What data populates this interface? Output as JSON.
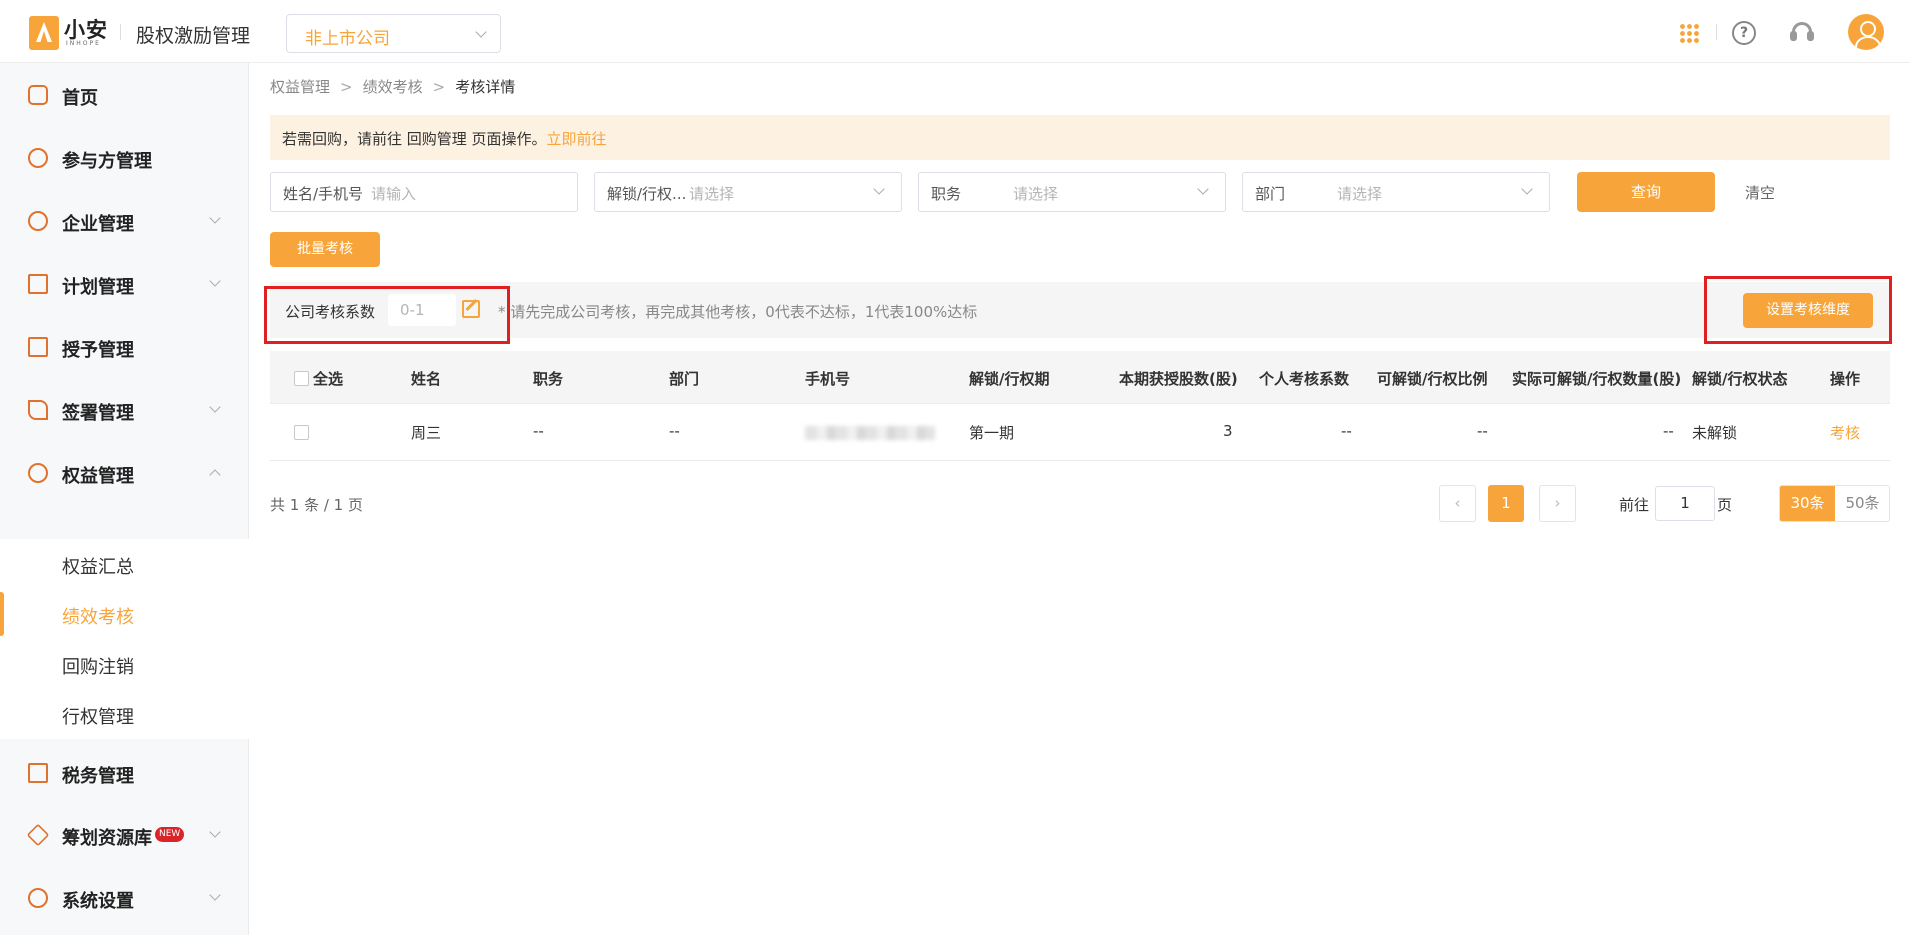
{
  "header": {
    "logo_text": "小安",
    "logo_sub": "INHOPE",
    "app_title": "股权激励管理",
    "company": "非上市公司"
  },
  "sidebar": {
    "items": [
      {
        "label": "首页",
        "icon": "home-icon"
      },
      {
        "label": "参与方管理",
        "icon": "users-icon"
      },
      {
        "label": "企业管理",
        "icon": "enterprise-icon"
      },
      {
        "label": "计划管理",
        "icon": "plan-icon"
      },
      {
        "label": "授予管理",
        "icon": "grant-icon"
      },
      {
        "label": "签署管理",
        "icon": "sign-icon"
      },
      {
        "label": "权益管理",
        "icon": "equity-icon"
      },
      {
        "label": "税务管理",
        "icon": "tax-icon"
      },
      {
        "label": "筹划资源库",
        "icon": "layers-icon",
        "badge": "NEW"
      },
      {
        "label": "系统设置",
        "icon": "settings-icon"
      }
    ],
    "sub_items": [
      "权益汇总",
      "绩效考核",
      "回购注销",
      "行权管理"
    ],
    "active_sub": "绩效考核"
  },
  "breadcrumb": [
    "权益管理",
    "绩效考核",
    "考核详情"
  ],
  "notice": {
    "text": "若需回购，请前往 回购管理 页面操作。",
    "link": "立即前往"
  },
  "filters": {
    "name_label": "姓名/手机号",
    "name_placeholder": "请输入",
    "period_label": "解锁/行权...",
    "period_placeholder": "请选择",
    "position_label": "职务",
    "position_placeholder": "请选择",
    "dept_label": "部门",
    "dept_placeholder": "请选择",
    "query": "查询",
    "clear": "清空"
  },
  "batch_button": "批量考核",
  "coefficient": {
    "label": "公司考核系数",
    "placeholder": "0-1",
    "note": "* 请先完成公司考核，再完成其他考核，0代表不达标，1代表100%达标",
    "set_dimension": "设置考核维度"
  },
  "table": {
    "columns": [
      "全选",
      "姓名",
      "职务",
      "部门",
      "手机号",
      "解锁/行权期",
      "本期获授股数(股)",
      "个人考核系数",
      "可解锁/行权比例",
      "实际可解锁/行权数量(股)",
      "解锁/行权状态",
      "操作"
    ],
    "rows": [
      {
        "name": "周三",
        "position": "--",
        "dept": "--",
        "phone": "",
        "period": "第一期",
        "shares": "3",
        "personal_coef": "--",
        "ratio": "--",
        "actual": "--",
        "status": "未解锁",
        "action": "考核"
      }
    ]
  },
  "pagination": {
    "total_text": "共 1 条 / 1 页",
    "current_page": "1",
    "goto_label": "前往",
    "goto_value": "1",
    "page_suffix": "页",
    "sizes": [
      "30条",
      "50条"
    ],
    "selected_size": "30条"
  },
  "colors": {
    "accent": "#f7a53a",
    "highlight_box": "#e02020",
    "notice_bg": "#fdf1e2"
  }
}
